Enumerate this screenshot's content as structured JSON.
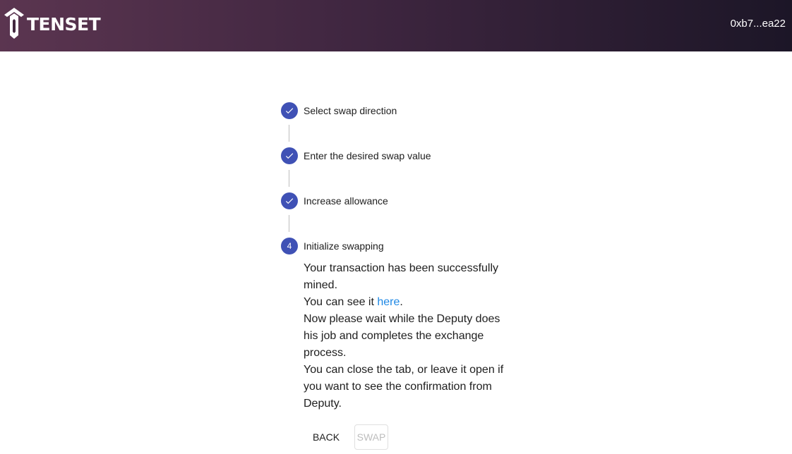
{
  "header": {
    "logo_text": "TENSET",
    "wallet_address": "0xb7...ea22"
  },
  "steps": [
    {
      "label": "Select swap direction",
      "status": "completed",
      "icon": "check-icon"
    },
    {
      "label": "Enter the desired swap value",
      "status": "completed",
      "icon": "check-icon"
    },
    {
      "label": "Increase allowance",
      "status": "completed",
      "icon": "check-icon"
    },
    {
      "label": "Initialize swapping",
      "status": "active",
      "number": "4"
    }
  ],
  "message": {
    "line1": "Your transaction has been successfully mined.",
    "line2_prefix": "You can see it ",
    "line2_link": "here",
    "line2_suffix": ".",
    "line3": "Now please wait while the Deputy does his job and completes the exchange process.",
    "line4": "You can close the tab, or leave it open if you want to see the confirmation from Deputy."
  },
  "actions": {
    "back_label": "BACK",
    "swap_label": "SWAP"
  },
  "colors": {
    "step_icon": "#3f51b5",
    "link": "#1e88e5",
    "header_start": "#5b3550",
    "header_end": "#1c1627"
  }
}
